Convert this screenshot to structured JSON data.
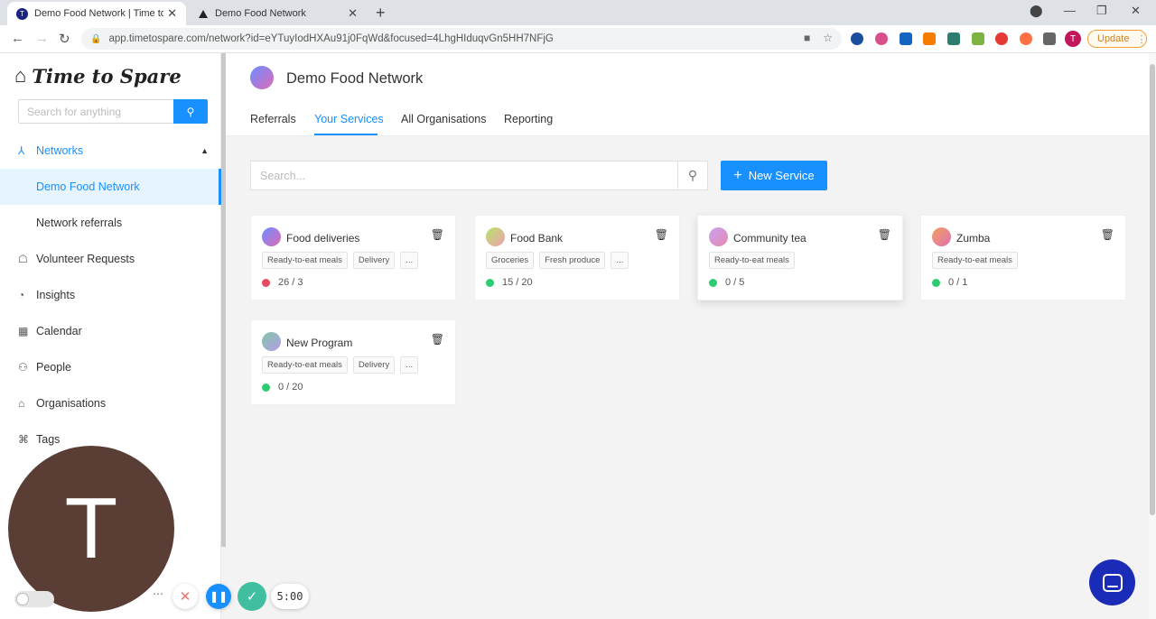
{
  "browser": {
    "tabs": [
      {
        "title": "Demo Food Network | Time to Spare",
        "active": true
      },
      {
        "title": "Demo Food Network",
        "active": false
      }
    ],
    "url": "app.timetospare.com/network?id=eYTuyIodHXAu91j0FqWd&focused=4LhgHIduqvGn5HH7NFjG",
    "update_label": "Update",
    "profile_initial": "T"
  },
  "sidebar": {
    "brand": "Time to Spare",
    "search_placeholder": "Search for anything",
    "items": [
      {
        "label": "Networks",
        "icon": "network-icon"
      },
      {
        "label": "Demo Food Network"
      },
      {
        "label": "Network referrals"
      },
      {
        "label": "Volunteer Requests",
        "icon": "hand-icon"
      },
      {
        "label": "Insights",
        "icon": "pie-chart-icon"
      },
      {
        "label": "Calendar",
        "icon": "calendar-icon"
      },
      {
        "label": "People",
        "icon": "people-icon"
      },
      {
        "label": "Organisations",
        "icon": "bank-icon"
      },
      {
        "label": "Tags",
        "icon": "tag-icon"
      }
    ]
  },
  "header": {
    "network_name": "Demo Food Network",
    "tabs": [
      "Referrals",
      "Your Services",
      "All Organisations",
      "Reporting"
    ],
    "active_tab": "Your Services"
  },
  "toolbar": {
    "search_placeholder": "Search...",
    "new_service_label": "New Service"
  },
  "services": [
    {
      "name": "Food deliveries",
      "tags": [
        "Ready-to-eat meals",
        "Delivery",
        "..."
      ],
      "count": "26 / 3",
      "status_color": "#e84a5f"
    },
    {
      "name": "Food Bank",
      "tags": [
        "Groceries",
        "Fresh produce",
        "..."
      ],
      "count": "15 / 20",
      "status_color": "#2ecc71"
    },
    {
      "name": "Community tea",
      "tags": [
        "Ready-to-eat meals"
      ],
      "count": "0 / 5",
      "status_color": "#2ecc71"
    },
    {
      "name": "Zumba",
      "tags": [
        "Ready-to-eat meals"
      ],
      "count": "0 / 1",
      "status_color": "#2ecc71"
    },
    {
      "name": "New Program",
      "tags": [
        "Ready-to-eat meals",
        "Delivery",
        "..."
      ],
      "count": "0 / 20",
      "status_color": "#2ecc71"
    }
  ],
  "recorder": {
    "webcam_initial": "T",
    "timer": "5:00"
  },
  "colors": {
    "accent": "#1890ff",
    "danger": "#e84a5f",
    "success": "#2ecc71"
  }
}
